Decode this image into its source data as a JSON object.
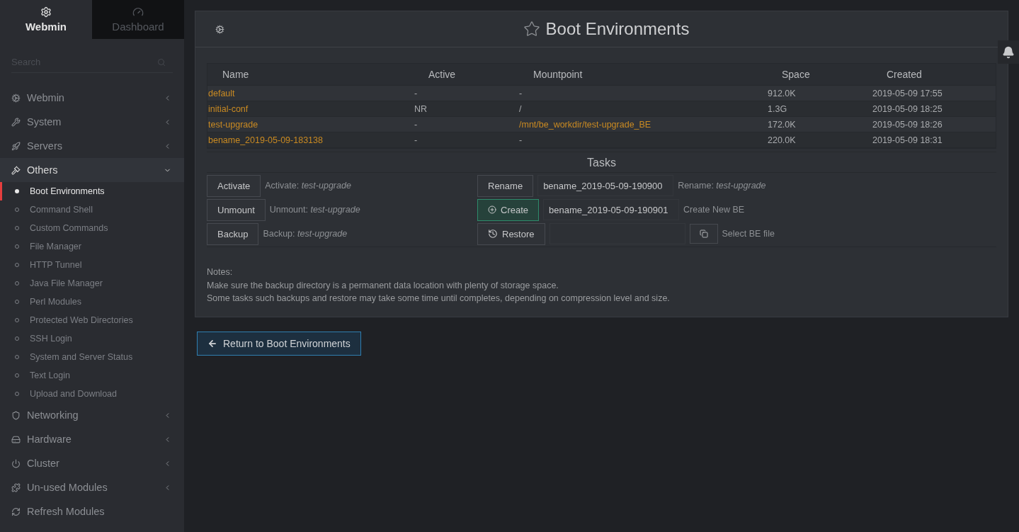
{
  "top_tabs": [
    {
      "label": "Webmin",
      "selected": true
    },
    {
      "label": "Dashboard",
      "selected": false
    }
  ],
  "search": {
    "placeholder": "Search"
  },
  "menu": [
    {
      "label": "Webmin",
      "expanded": false
    },
    {
      "label": "System",
      "expanded": false
    },
    {
      "label": "Servers",
      "expanded": false
    },
    {
      "label": "Others",
      "expanded": true,
      "children": [
        {
          "label": "Boot Environments",
          "selected": true
        },
        {
          "label": "Command Shell",
          "selected": false
        },
        {
          "label": "Custom Commands",
          "selected": false
        },
        {
          "label": "File Manager",
          "selected": false
        },
        {
          "label": "HTTP Tunnel",
          "selected": false
        },
        {
          "label": "Java File Manager",
          "selected": false
        },
        {
          "label": "Perl Modules",
          "selected": false
        },
        {
          "label": "Protected Web Directories",
          "selected": false
        },
        {
          "label": "SSH Login",
          "selected": false
        },
        {
          "label": "System and Server Status",
          "selected": false
        },
        {
          "label": "Text Login",
          "selected": false
        },
        {
          "label": "Upload and Download",
          "selected": false
        }
      ]
    },
    {
      "label": "Networking",
      "expanded": false
    },
    {
      "label": "Hardware",
      "expanded": false
    },
    {
      "label": "Cluster",
      "expanded": false
    },
    {
      "label": "Un-used Modules",
      "expanded": false
    },
    {
      "label": "Refresh Modules",
      "kind": "action"
    }
  ],
  "panel": {
    "title": "Boot Environments",
    "table": {
      "columns": [
        "Name",
        "Active",
        "Mountpoint",
        "Space",
        "Created"
      ],
      "rows": [
        {
          "cells": [
            {
              "text": "default",
              "link": true
            },
            {
              "text": "-",
              "link": false
            },
            {
              "text": "-",
              "link": false
            },
            {
              "text": "912.0K",
              "link": false
            },
            {
              "text": "2019-05-09 17:55",
              "link": false
            }
          ]
        },
        {
          "cells": [
            {
              "text": "initial-conf",
              "link": true
            },
            {
              "text": "NR",
              "link": false
            },
            {
              "text": "/",
              "link": false
            },
            {
              "text": "1.3G",
              "link": false
            },
            {
              "text": "2019-05-09 18:25",
              "link": false
            }
          ]
        },
        {
          "cells": [
            {
              "text": "test-upgrade",
              "link": true
            },
            {
              "text": "-",
              "link": false
            },
            {
              "text": "/mnt/be_workdir/test-upgrade_BE",
              "link": true
            },
            {
              "text": "172.0K",
              "link": false
            },
            {
              "text": "2019-05-09 18:26",
              "link": false
            }
          ]
        },
        {
          "cells": [
            {
              "text": "bename_2019-05-09-183138",
              "link": true
            },
            {
              "text": "-",
              "link": false
            },
            {
              "text": "-",
              "link": false
            },
            {
              "text": "220.0K",
              "link": false
            },
            {
              "text": "2019-05-09 18:31",
              "link": false
            }
          ]
        }
      ]
    },
    "tasks": {
      "title": "Tasks",
      "left": [
        {
          "button": "Activate",
          "hint": "Activate: *test-upgrade*"
        },
        {
          "button": "Unmount",
          "hint": "Unmount: *test-upgrade*"
        },
        {
          "button": "Backup",
          "hint": "Backup: *test-upgrade*"
        }
      ],
      "right": [
        {
          "kind": "plain",
          "button": "Rename",
          "value": "bename_2019-05-09-190900",
          "hint": "Rename: *test-upgrade*"
        },
        {
          "kind": "create",
          "button": "Create",
          "value": "bename_2019-05-09-190901",
          "hint": "Create New BE"
        },
        {
          "kind": "restore",
          "button": "Restore",
          "hint": "Select BE file"
        }
      ]
    },
    "notes": [
      "Notes:",
      "Make sure the backup directory is a permanent data location with plenty of storage space.",
      "Some tasks such backups and restore may take some time until completes, depending on compression level and size."
    ]
  },
  "return_button": "Return to Boot Environments"
}
